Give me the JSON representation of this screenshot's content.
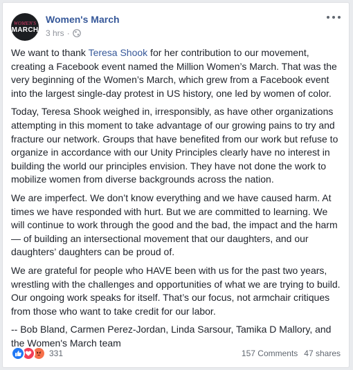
{
  "post": {
    "page_name": "Women's March",
    "avatar": {
      "line1": "WOMEN'S",
      "line2": "MARCH"
    },
    "time": "3 hrs",
    "separator": "·",
    "paragraphs": [
      {
        "before": "We want to thank ",
        "link": "Teresa Shook",
        "after": " for her contribution to our movement, creating a Facebook event named the Million Women’s March. That was the very beginning of the Women’s March, which grew from a Facebook event into the largest single-day protest in US history, one led by women of color."
      },
      {
        "text": "Today, Teresa Shook weighed in, irresponsibly, as have other organizations attempting in this moment to take advantage of our growing pains to try and fracture our network. Groups that have benefited from our work but refuse to organize in accordance with our Unity Principles clearly have no interest in building the world our principles envision. They have not done the work to mobilize women from diverse backgrounds across the nation."
      },
      {
        "text": "We are imperfect. We don’t know everything and we have caused harm. At times we have responded with hurt. But we are committed to learning. We will continue to work through the good and the bad, the impact and the harm — of building an intersectional movement that our daughters, and our daughters’ daughters can be proud of."
      },
      {
        "text": "We are grateful for people who HAVE been with us for the past two years, wrestling with the challenges and opportunities of what we are trying to build. Our ongoing work speaks for itself. That’s our focus, not armchair critiques from those who want to take credit for our labor."
      },
      {
        "text": "-- Bob Bland, Carmen Perez-Jordan, Linda Sarsour, Tamika D Mallory, and the Women's March team"
      }
    ]
  },
  "footer": {
    "reactions": [
      "like-icon",
      "love-icon",
      "angry-icon"
    ],
    "reaction_count": "331",
    "comments": "157 Comments",
    "shares": "47 shares"
  },
  "colors": {
    "link": "#365899",
    "like": "#2078f4",
    "love": "#f33e58",
    "angry": "#f7714b",
    "text": "#1d2129",
    "meta": "#90949c"
  }
}
